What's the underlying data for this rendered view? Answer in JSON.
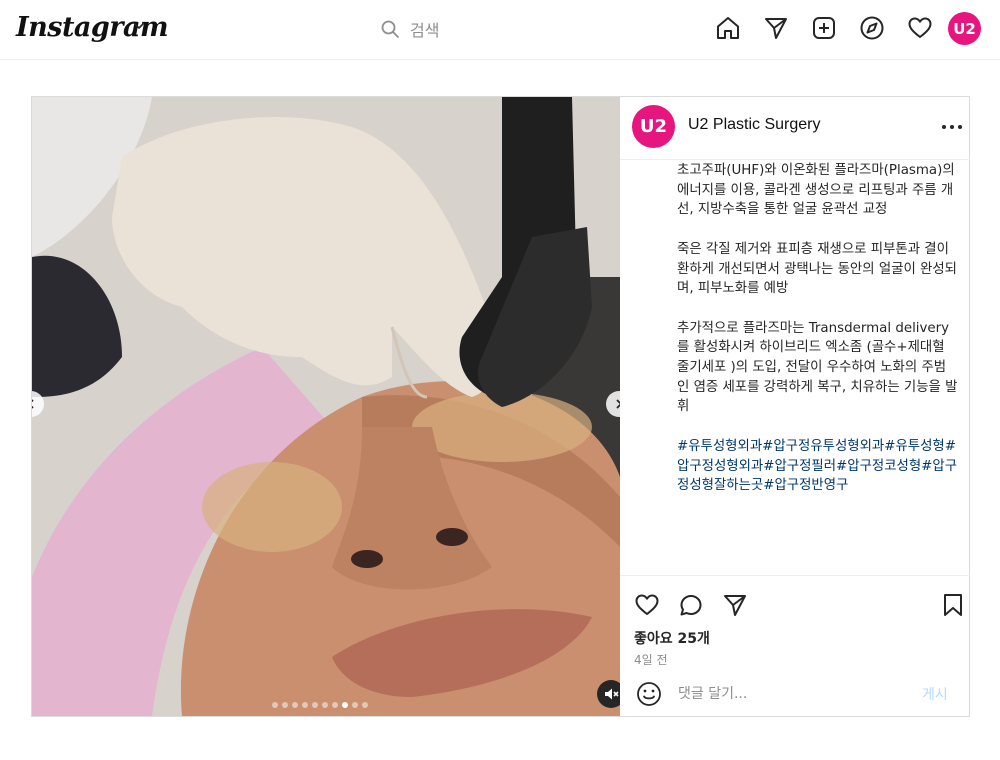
{
  "header": {
    "logo": "Instagram",
    "search_placeholder": "검색",
    "avatar_text": "U2",
    "nav_icons": [
      "home-icon",
      "send-icon",
      "new-post-icon",
      "explore-icon",
      "heart-icon"
    ]
  },
  "post": {
    "account_name": "U2 Plastic Surgery",
    "avatar_text": "U2",
    "caption_paragraphs": [
      "초고주파(UHF)와 이온화된 플라즈마(Plasma)의 에너지를 이용, 콜라겐 생성으로 리프팅과 주름 개선, 지방수축을 통한 얼굴 윤곽선 교정",
      "죽은 각질 제거와 표피층 재생으로 피부톤과 결이 환하게 개선되면서 광택나는 동안의 얼굴이 완성되며, 피부노화를 예방",
      "추가적으로 플라즈마는 Transdermal delivery를 활성화시켜 하이브리드 엑소좀 (골수+제대혈 줄기세포 )의 도입, 전달이 우수하여 노화의 주범인 염증 세포를 강력하게 복구, 치유하는 기능을 발휘"
    ],
    "hashtags": "#유투성형외과#압구정유투성형외과#유투성형#압구정성형외과#압구정필러#압구정코성형#압구정성형잘하는곳#압구정반영구",
    "likes": "좋아요 25개",
    "time": "4일 전",
    "comment_placeholder": "댓글 달기...",
    "post_button": "게시",
    "carousel": {
      "count": 10,
      "active_index": 7
    }
  },
  "colors": {
    "brand_pink": "#e6167e",
    "link_blue": "#00376b",
    "post_button_disabled": "#b3dbff",
    "muted_text": "#8e8e8e"
  }
}
